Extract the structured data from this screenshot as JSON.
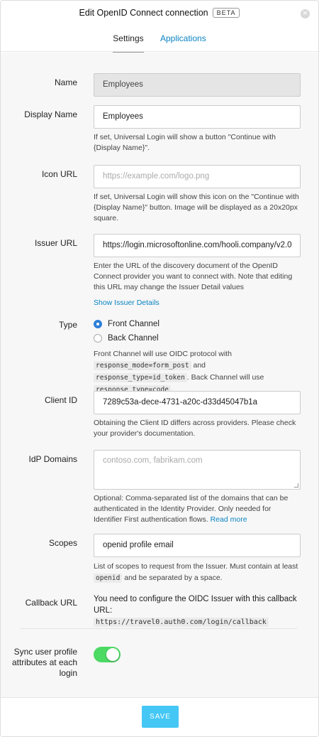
{
  "header": {
    "title": "Edit OpenID Connect connection",
    "badge": "BETA",
    "close_icon": "close-icon",
    "tabs": [
      {
        "label": "Settings",
        "active": true
      },
      {
        "label": "Applications",
        "active": false
      }
    ]
  },
  "form": {
    "name": {
      "label": "Name",
      "value": "Employees"
    },
    "display_name": {
      "label": "Display Name",
      "value": "Employees",
      "help": "If set, Universal Login will show a button \"Continue with {Display Name}\"."
    },
    "icon_url": {
      "label": "Icon URL",
      "placeholder": "https://example.com/logo.png",
      "help": "If set, Universal Login will show this icon on the \"Continue with {Display Name}\" button. Image will be displayed as a 20x20px square."
    },
    "issuer_url": {
      "label": "Issuer URL",
      "value": "https://login.microsoftonline.com/hooli.company/v2.0",
      "help": "Enter the URL of the discovery document of the OpenID Connect provider you want to connect with. Note that editing this URL may change the Issuer Detail values",
      "link": "Show Issuer Details"
    },
    "type": {
      "label": "Type",
      "options": [
        {
          "label": "Front Channel",
          "checked": true
        },
        {
          "label": "Back Channel",
          "checked": false
        }
      ],
      "help_parts": {
        "p1": "Front Channel will use OIDC protocol with",
        "code1": "response_mode=form_post",
        "p2": "and",
        "code2": "response_type=id_token",
        "p3": ". Back Channel will use",
        "code3": "response_type=code",
        "p4": "."
      }
    },
    "client_id": {
      "label": "Client ID",
      "value": "7289c53a-dece-4731-a20c-d33d45047b1a",
      "help": "Obtaining the Client ID differs across providers. Please check your provider's documentation."
    },
    "idp_domains": {
      "label": "IdP Domains",
      "placeholder": "contoso.com, fabrikam.com",
      "help": "Optional: Comma-separated list of the domains that can be authenticated in the Identity Provider. Only needed for Identifier First authentication flows.",
      "link": "Read more"
    },
    "scopes": {
      "label": "Scopes",
      "value": "openid profile email",
      "help_p1": "List of scopes to request from the Issuer. Must contain at least",
      "help_code": "openid",
      "help_p2": "and be separated by a space."
    },
    "callback_url": {
      "label": "Callback URL",
      "text": "You need to configure the OIDC Issuer with this callback URL:",
      "url": "https://travel0.auth0.com/login/callback"
    },
    "sync": {
      "label": "Sync user profile attributes at each login",
      "enabled": true
    }
  },
  "footer": {
    "save_label": "SAVE"
  },
  "colors": {
    "accent": "#0a84c2",
    "save": "#44c7f4",
    "toggle_on": "#4cd964",
    "radio": "#2f7fd8"
  }
}
